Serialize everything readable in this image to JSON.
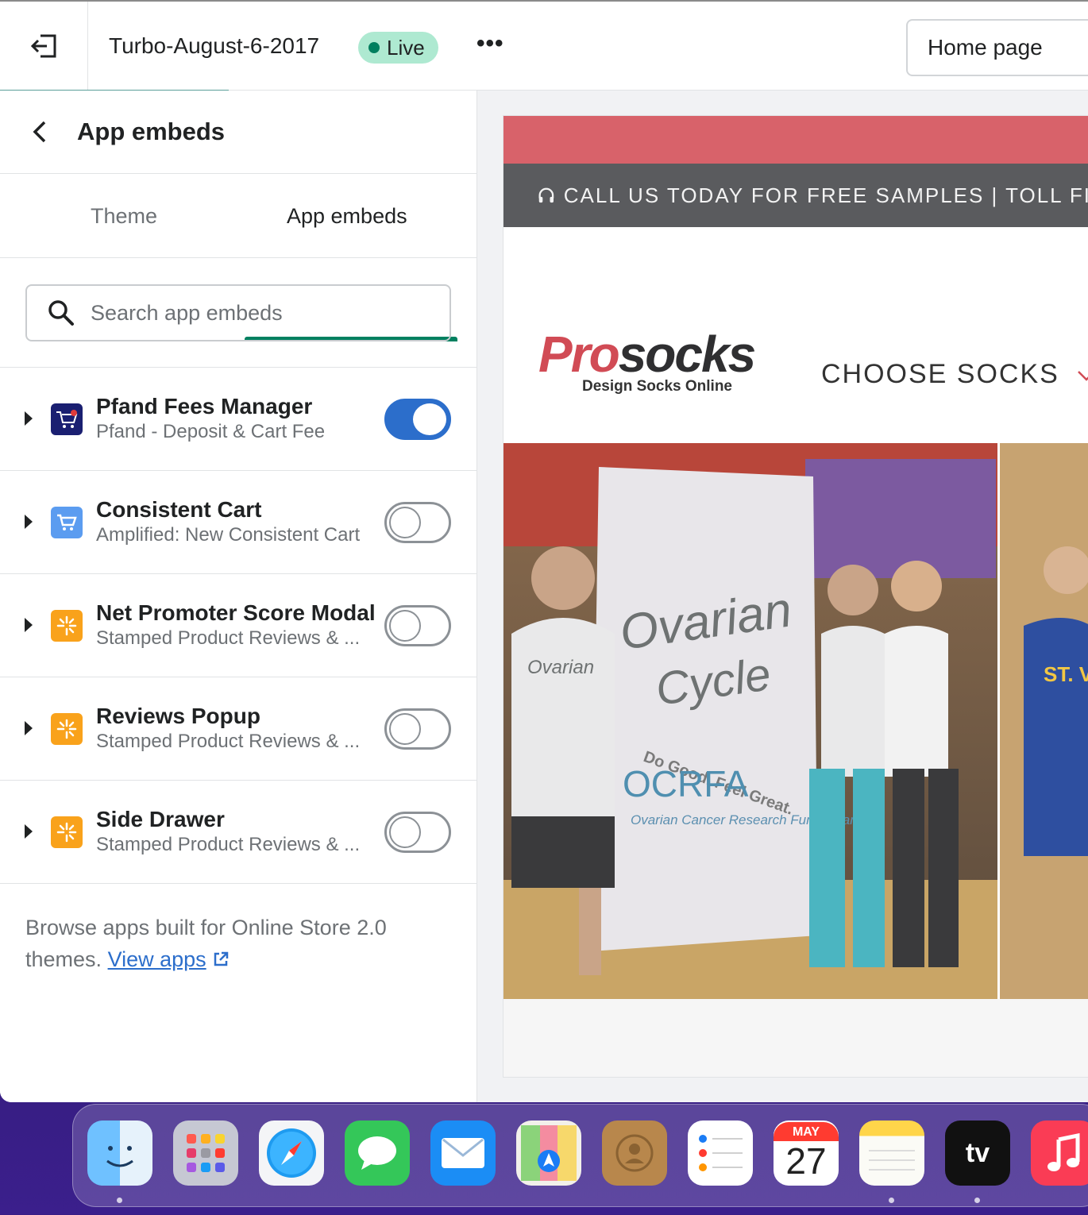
{
  "topbar": {
    "theme_name": "Turbo-August-6-2017",
    "status": "Live",
    "more": "•••",
    "page_select": "Home page"
  },
  "sidebar": {
    "title": "App embeds",
    "tabs": [
      {
        "label": "Theme",
        "active": false
      },
      {
        "label": "App embeds",
        "active": true
      }
    ],
    "search_placeholder": "Search app embeds",
    "embeds": [
      {
        "title": "Pfand Fees Manager",
        "subtitle": "Pfand - Deposit & Cart Fee",
        "enabled": true,
        "icon": "cart-fee-icon"
      },
      {
        "title": "Consistent Cart",
        "subtitle": "Amplified: New Consistent Cart",
        "enabled": false,
        "icon": "cart-icon"
      },
      {
        "title": "Net Promoter Score Modal",
        "subtitle": "Stamped Product Reviews & ...",
        "enabled": false,
        "icon": "stamped-icon"
      },
      {
        "title": "Reviews Popup",
        "subtitle": "Stamped Product Reviews & ...",
        "enabled": false,
        "icon": "stamped-icon"
      },
      {
        "title": "Side Drawer",
        "subtitle": "Stamped Product Reviews & ...",
        "enabled": false,
        "icon": "stamped-icon"
      }
    ],
    "footer_text": "Browse apps built for Online Store 2.0 themes.",
    "footer_link": "View apps"
  },
  "preview": {
    "call_bar": "CALL US TODAY FOR FREE SAMPLES | TOLL FI",
    "logo_pro": "Pro",
    "logo_socks": "socks",
    "logo_tagline": "Design Socks Online",
    "nav_item": "CHOOSE SOCKS",
    "banner_text_1": "Ovarian",
    "banner_text_2": "Cycle",
    "banner_text_3": "Do Good. Feel Great.",
    "banner_text_4": "OCRFA",
    "banner_text_5": "Ovarian Cancer Research Fund Alliance",
    "shirt_text": "ST. V"
  },
  "dock": {
    "apps": [
      "Finder",
      "Launchpad",
      "Safari",
      "Messages",
      "Mail",
      "Maps",
      "Contacts",
      "Reminders",
      "Calendar",
      "Notes",
      "TV",
      "Music"
    ],
    "calendar_month": "MAY",
    "calendar_day": "27",
    "tv_label": "tv"
  },
  "colors": {
    "accent": "#008060",
    "toggle_on": "#2c6ecb",
    "live_badge": "#aee9d1",
    "pink_bar": "#d8626a",
    "call_bar": "#5a5b5e"
  }
}
